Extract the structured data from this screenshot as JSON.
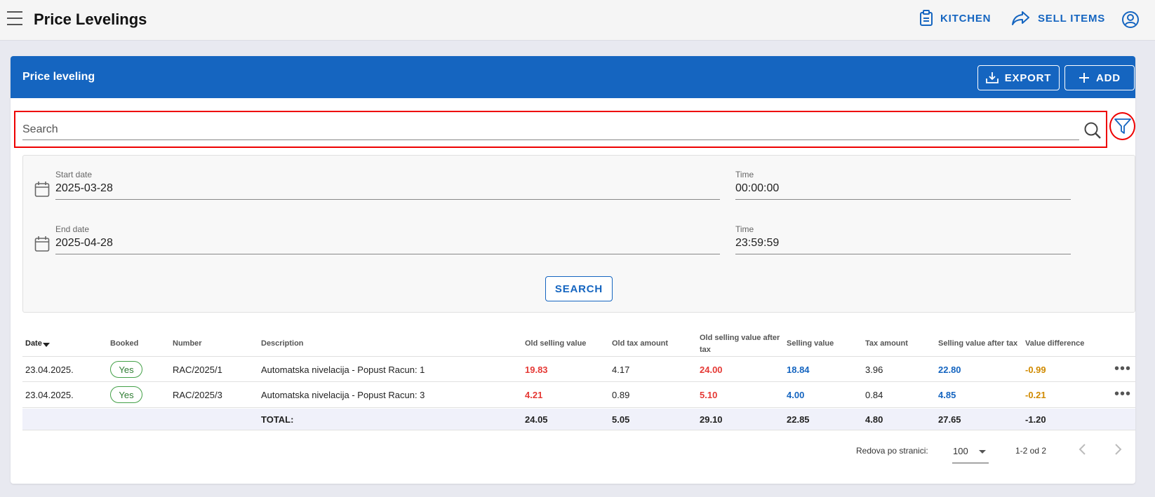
{
  "app": {
    "title": "Price Levelings"
  },
  "topnav": {
    "kitchen": "KITCHEN",
    "sell_items": "SELL ITEMS"
  },
  "card": {
    "title": "Price leveling",
    "export_label": "EXPORT",
    "add_label": "ADD"
  },
  "search": {
    "placeholder": "Search",
    "value": ""
  },
  "filters": {
    "start_date_label": "Start date",
    "start_date": "2025-03-28",
    "start_time_label": "Time",
    "start_time": "00:00:00",
    "end_date_label": "End date",
    "end_date": "2025-04-28",
    "end_time_label": "Time",
    "end_time": "23:59:59",
    "search_button": "SEARCH"
  },
  "table": {
    "headers": {
      "date": "Date",
      "booked": "Booked",
      "number": "Number",
      "description": "Description",
      "old_selling_value": "Old selling value",
      "old_tax_amount": "Old tax amount",
      "old_selling_value_after_tax": "Old selling value after tax",
      "selling_value": "Selling value",
      "tax_amount": "Tax amount",
      "selling_value_after_tax": "Selling value after tax",
      "value_difference": "Value difference"
    },
    "rows": [
      {
        "date": "23.04.2025.",
        "booked": "Yes",
        "number": "RAC/2025/1",
        "description": "Automatska nivelacija - Popust Racun: 1",
        "old_selling_value": "19.83",
        "old_tax_amount": "4.17",
        "old_selling_value_after_tax": "24.00",
        "selling_value": "18.84",
        "tax_amount": "3.96",
        "selling_value_after_tax": "22.80",
        "value_difference": "-0.99"
      },
      {
        "date": "23.04.2025.",
        "booked": "Yes",
        "number": "RAC/2025/3",
        "description": "Automatska nivelacija - Popust Racun: 3",
        "old_selling_value": "4.21",
        "old_tax_amount": "0.89",
        "old_selling_value_after_tax": "5.10",
        "selling_value": "4.00",
        "tax_amount": "0.84",
        "selling_value_after_tax": "4.85",
        "value_difference": "-0.21"
      }
    ],
    "total": {
      "label": "TOTAL:",
      "old_selling_value": "24.05",
      "old_tax_amount": "5.05",
      "old_selling_value_after_tax": "29.10",
      "selling_value": "22.85",
      "tax_amount": "4.80",
      "selling_value_after_tax": "27.65",
      "value_difference": "-1.20"
    }
  },
  "pagination": {
    "rows_per_page_label": "Redova po stranici:",
    "rows_per_page": "100",
    "range": "1-2 od 2"
  },
  "icons": [
    "menu-icon",
    "clipboard-icon",
    "share-arrow-icon",
    "account-icon",
    "download-icon",
    "plus-icon",
    "search-icon",
    "filter-icon",
    "calendar-icon",
    "sort-desc-icon",
    "more-icon",
    "chevron-left-icon",
    "chevron-right-icon"
  ],
  "colors": {
    "primary": "#1565c0",
    "negative": "#e53935",
    "warning": "#d08a00",
    "success": "#43a047",
    "highlight": "#ee0000"
  }
}
